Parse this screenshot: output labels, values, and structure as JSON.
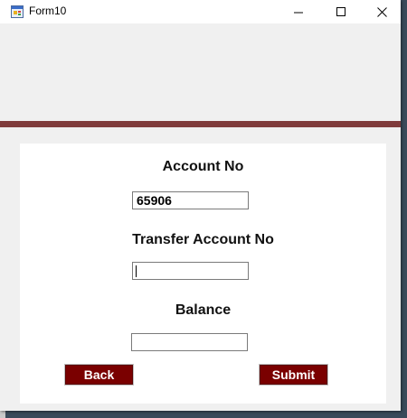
{
  "window": {
    "title": "Form10",
    "controls": {
      "minimize_glyph": "—",
      "maximize_glyph": "☐",
      "close_glyph": "✕"
    }
  },
  "colors": {
    "band": "#7f3b3b",
    "button": "#7a0000"
  },
  "form": {
    "account_no_label": "Account No",
    "account_no_value": "65906",
    "transfer_account_label": "Transfer Account No",
    "transfer_account_value": "",
    "balance_label": "Balance",
    "balance_value": "",
    "back_label": "Back",
    "submit_label": "Submit"
  }
}
